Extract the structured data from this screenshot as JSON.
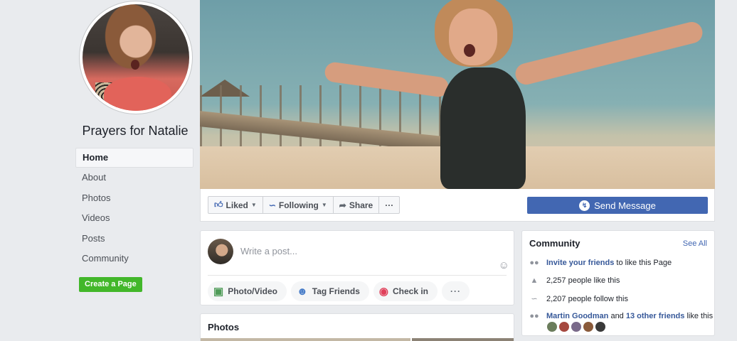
{
  "page": {
    "name": "Prayers for Natalie"
  },
  "nav": {
    "items": [
      {
        "label": "Home",
        "active": true
      },
      {
        "label": "About"
      },
      {
        "label": "Photos"
      },
      {
        "label": "Videos"
      },
      {
        "label": "Posts"
      },
      {
        "label": "Community"
      }
    ],
    "create_page": "Create a Page"
  },
  "actions": {
    "liked": "Liked",
    "following": "Following",
    "share": "Share",
    "more": "···",
    "send_message": "Send Message"
  },
  "composer": {
    "placeholder": "Write a post...",
    "options": [
      "Photo/Video",
      "Tag Friends",
      "Check in"
    ],
    "more": "···"
  },
  "photos": {
    "title": "Photos"
  },
  "community": {
    "title": "Community",
    "see_all": "See All",
    "invite_link": "Invite your friends",
    "invite_text": " to like this Page",
    "likes_text": "2,257 people like this",
    "follows_text": "2,207 people follow this",
    "friend_name": "Martin Goodman",
    "friend_and": " and ",
    "other_friends": "13 other friends",
    "friend_suffix": " like this",
    "face_colors": [
      "#6b7d5c",
      "#a5483f",
      "#7a6a8a",
      "#8a5a3a",
      "#3a3a3a"
    ]
  },
  "colors": {
    "brand": "#4267b2",
    "create_green": "#42b72a",
    "link": "#365899",
    "background": "#e9ebee"
  }
}
